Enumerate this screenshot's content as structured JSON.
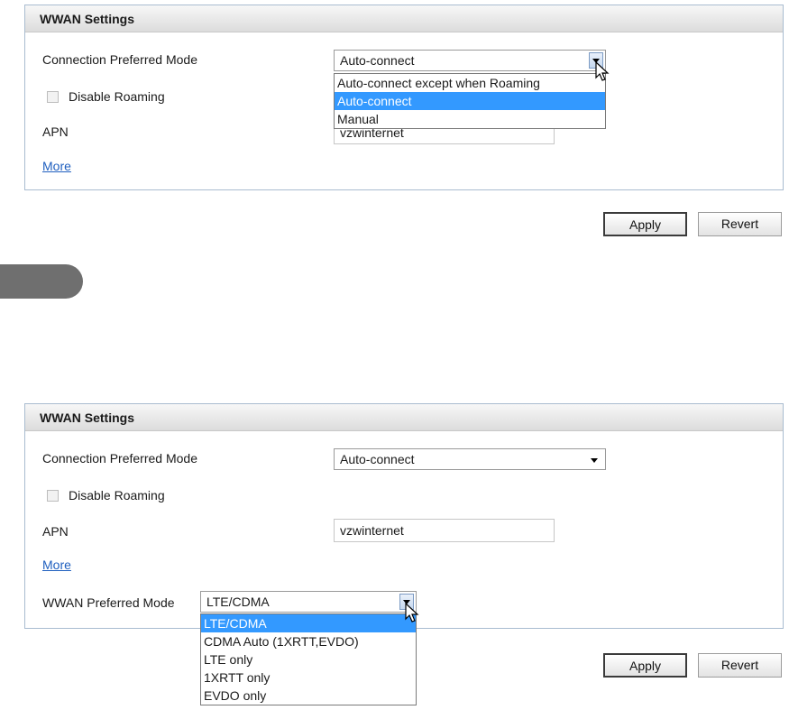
{
  "top": {
    "panel_title": "WWAN Settings",
    "connection_label": "Connection Preferred Mode",
    "connection_value": "Auto-connect",
    "connection_options": [
      {
        "label": "Auto-connect except when Roaming",
        "selected": false
      },
      {
        "label": "Auto-connect",
        "selected": true
      },
      {
        "label": "Manual",
        "selected": false
      }
    ],
    "roaming_label": "Disable Roaming",
    "roaming_checked": false,
    "apn_label": "APN",
    "apn_value": "vzwinternet",
    "more_link": "More",
    "apply_label": "Apply",
    "revert_label": "Revert"
  },
  "bottom": {
    "panel_title": "WWAN Settings",
    "connection_label": "Connection Preferred Mode",
    "connection_value": "Auto-connect",
    "roaming_label": "Disable Roaming",
    "roaming_checked": false,
    "apn_label": "APN",
    "apn_value": "vzwinternet",
    "more_link": "More",
    "wwan_mode_label": "WWAN Preferred Mode",
    "wwan_mode_value": "LTE/CDMA",
    "wwan_mode_options": [
      {
        "label": "LTE/CDMA",
        "selected": true
      },
      {
        "label": "CDMA Auto (1XRTT,EVDO)",
        "selected": false
      },
      {
        "label": "LTE only",
        "selected": false
      },
      {
        "label": "1XRTT only",
        "selected": false
      },
      {
        "label": "EVDO only",
        "selected": false
      }
    ],
    "apply_label": "Apply",
    "revert_label": "Revert"
  },
  "colors": {
    "selection": "#3399ff",
    "link": "#1f5fbf",
    "panel_border": "#a9bcd0"
  }
}
